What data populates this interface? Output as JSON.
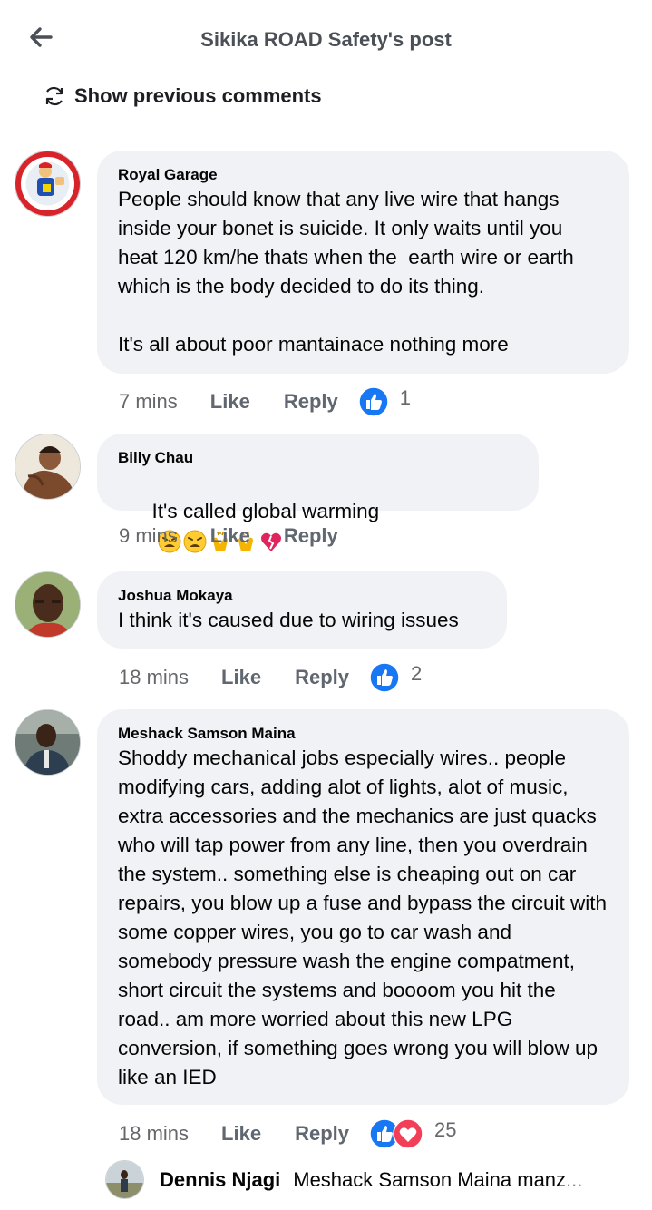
{
  "header": {
    "back_icon": "arrow-left-icon",
    "title": "Sikika ROAD Safety's post"
  },
  "previous": {
    "icon": "refresh-icon",
    "label": "Show previous comments"
  },
  "comments": [
    {
      "author": "Royal Garage",
      "text": "People should know that any live wire that hangs inside your bonet is suicide. It only waits until you heat 120 km/he thats when the  earth wire or earth which is the body decided to do its thing.\n\nIt's all about poor mantainace nothing more",
      "time": "7 mins",
      "like": "Like",
      "reply": "Reply",
      "reactions": "1"
    },
    {
      "author": "Billy Chau",
      "text": "It's called global warming",
      "emojis": [
        "tired-face-emoji",
        "tired-face-emoji",
        "clapping-hands-emoji",
        "clapping-hands-emoji",
        "broken-heart-emoji"
      ],
      "time": "9 mins",
      "like": "Like",
      "reply": "Reply"
    },
    {
      "author": "Joshua Mokaya",
      "text": "I think it's caused due to wiring issues",
      "time": "18 mins",
      "like": "Like",
      "reply": "Reply",
      "reactions": "2"
    },
    {
      "author": "Meshack Samson Maina",
      "text": "Shoddy mechanical jobs especially wires.. people modifying cars, adding alot of lights, alot of music, extra accessories and the mechanics are just quacks who will tap power from any line, then you overdrain the system.. something else is cheaping out on car repairs, you blow up a fuse and bypass the circuit with some copper wires, you go to car wash and somebody pressure wash the engine compatment, short circuit the systems and boooom you hit the road.. am more worried about this new LPG conversion, if something goes wrong you will blow up like an IED",
      "time": "18 mins",
      "like": "Like",
      "reply": "Reply",
      "reactions": "25"
    }
  ],
  "reply": {
    "author": "Dennis Njagi",
    "text": "Meshack Samson Maina manz",
    "ellipsis": "..."
  },
  "colors": {
    "like_blue": "#1877f2",
    "love_red": "#f33e58",
    "bubble": "#f0f2f5",
    "meta": "#65676b"
  }
}
